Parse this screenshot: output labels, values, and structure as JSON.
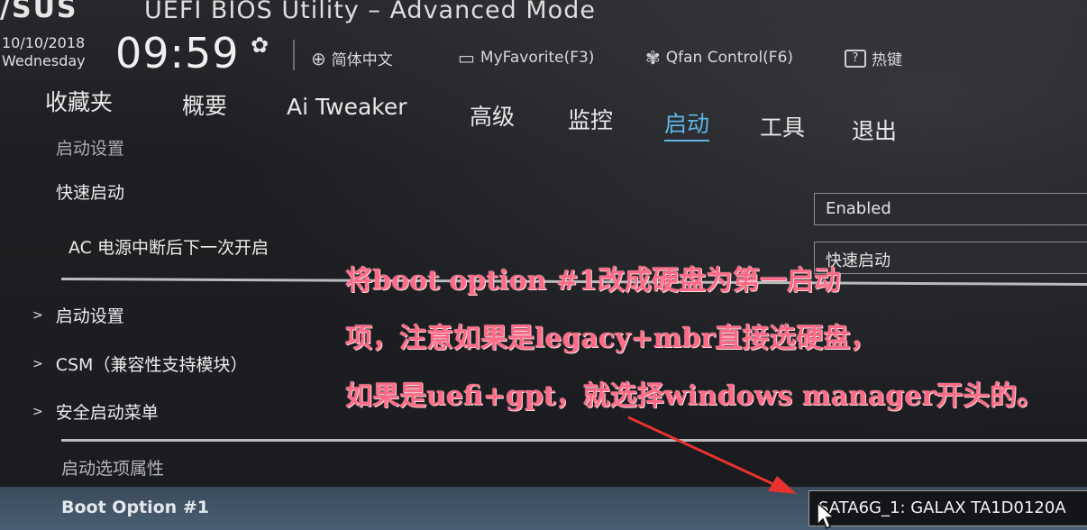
{
  "title_bar": {
    "logo": "/SUS",
    "title": "UEFI BIOS Utility – Advanced Mode"
  },
  "status": {
    "date": "10/10/2018",
    "weekday": "Wednesday",
    "time": "09:59",
    "tools": [
      {
        "icon": "globe-icon",
        "label": "简体中文"
      },
      {
        "icon": "favorite-icon",
        "label": "MyFavorite(F3)"
      },
      {
        "icon": "fan-icon",
        "label": "Qfan Control(F6)"
      },
      {
        "icon": "help-key-icon",
        "label": "热键"
      }
    ]
  },
  "nav": {
    "tabs": [
      "收藏夹",
      "概要",
      "Ai Tweaker",
      "高级",
      "监控",
      "启动",
      "工具",
      "退出"
    ],
    "active": "启动"
  },
  "content": {
    "section_title": "启动设置",
    "fast_boot_label": "快速启动",
    "fast_boot_value": "Enabled",
    "ac_power_label": "AC 电源中断后下一次开启",
    "ac_power_value": "快速启动",
    "sub_items": [
      "启动设置",
      "CSM（兼容性支持模块）",
      "安全启动菜单"
    ],
    "boot_props_title": "启动选项属性",
    "boot_option_label": "Boot Option #1",
    "boot_option_value": "SATA6G_1: GALAX TA1D0120A"
  },
  "annotation": {
    "lines": [
      "将boot option #1改成硬盘为第一启动",
      "项，注意如果是legacy+mbr直接选硬盘，",
      "如果是uefi+gpt，就选择windows manager开头的。"
    ],
    "color": "#ff6a86"
  }
}
